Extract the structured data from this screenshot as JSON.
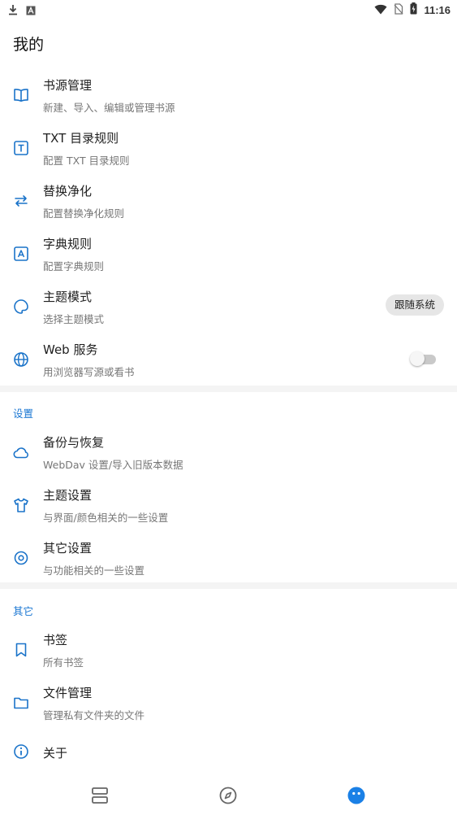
{
  "status_bar": {
    "time": "11:16",
    "left_icons": [
      "download-icon",
      "a-notification-icon"
    ],
    "right_icons": [
      "wifi-icon",
      "no-sim-icon",
      "battery-charging-icon"
    ]
  },
  "page": {
    "title": "我的"
  },
  "main_items": [
    {
      "icon": "book-open-icon",
      "title": "书源管理",
      "subtitle": "新建、导入、编辑或管理书源"
    },
    {
      "icon": "txt-icon",
      "title": "TXT 目录规则",
      "subtitle": "配置 TXT 目录规则"
    },
    {
      "icon": "replace-icon",
      "title": "替换净化",
      "subtitle": "配置替换净化规则"
    },
    {
      "icon": "dictionary-icon",
      "title": "字典规则",
      "subtitle": "配置字典规则"
    },
    {
      "icon": "theme-icon",
      "title": "主题模式",
      "subtitle": "选择主题模式",
      "value": "跟随系统"
    },
    {
      "icon": "globe-icon",
      "title": "Web 服务",
      "subtitle": "用浏览器写源或看书",
      "toggle": false
    }
  ],
  "settings_section": {
    "label": "设置",
    "items": [
      {
        "icon": "cloud-icon",
        "title": "备份与恢复",
        "subtitle": "WebDav 设置/导入旧版本数据"
      },
      {
        "icon": "shirt-icon",
        "title": "主题设置",
        "subtitle": "与界面/颜色相关的一些设置"
      },
      {
        "icon": "settings-icon",
        "title": "其它设置",
        "subtitle": "与功能相关的一些设置"
      }
    ]
  },
  "other_section": {
    "label": "其它",
    "items": [
      {
        "icon": "bookmark-icon",
        "title": "书签",
        "subtitle": "所有书签"
      },
      {
        "icon": "folder-icon",
        "title": "文件管理",
        "subtitle": "管理私有文件夹的文件"
      },
      {
        "icon": "info-icon",
        "title": "关于"
      }
    ]
  },
  "bottom_nav": {
    "items": [
      {
        "icon": "bookshelf-icon",
        "active": false
      },
      {
        "icon": "compass-icon",
        "active": false
      },
      {
        "icon": "my-face-icon",
        "active": true
      }
    ],
    "accent_color": "#1a80e6",
    "icon_color": "#666666"
  },
  "colors": {
    "accent": "#1976d2",
    "subtitle": "#777777",
    "divider": "#f4f4f4"
  }
}
